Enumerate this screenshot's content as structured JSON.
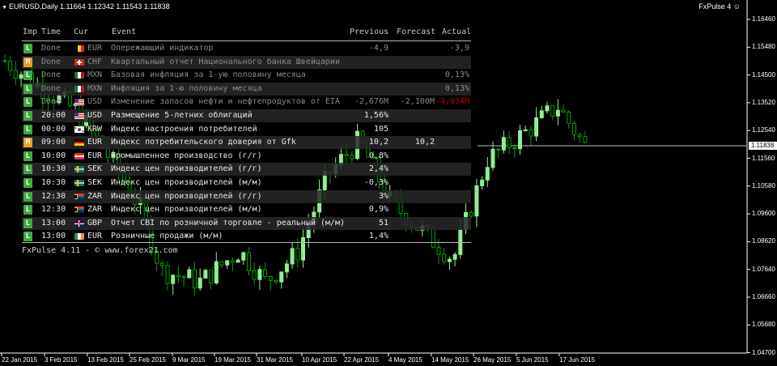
{
  "window": {
    "symbol_info": "EURUSD,Daily  1.11664 1.12342 1.11543 1.11838",
    "indicator_name": "FxPulse 4",
    "smiley": "☺"
  },
  "price_axis": {
    "labels": [
      "1.16460",
      "1.15480",
      "1.14500",
      "1.13520",
      "1.12540",
      "1.11560",
      "1.10580",
      "1.09600",
      "1.08620",
      "1.07640",
      "1.06660",
      "1.05680",
      "1.04700"
    ],
    "current_price": "1.11838"
  },
  "date_axis": {
    "labels": [
      "22 Jan 2015",
      "3 Feb 2015",
      "13 Feb 2015",
      "25 Feb 2015",
      "9 Mar 2015",
      "19 Mar 2015",
      "31 Mar 2015",
      "10 Apr 2015",
      "22 Apr 2015",
      "4 May 2015",
      "14 May 2015",
      "26 May 2015",
      "5 Jun 2015",
      "17 Jun 2015"
    ]
  },
  "colors": {
    "bull": "#90ee90",
    "bear": "#00a000",
    "imp_low": "#3caa3c",
    "imp_medium": "#e8a020",
    "negative_actual": "#cc0000"
  },
  "calendar": {
    "headers": {
      "imp": "Imp",
      "time": "Time",
      "cur": "Cur",
      "event": "Event",
      "previous": "Previous",
      "forecast": "Forecast",
      "actual": "Actual"
    },
    "rows": [
      {
        "imp": "L",
        "time": "Done",
        "cur": "EUR",
        "flag": "be",
        "event": "Опережающий индикатор",
        "previous": "-4,9",
        "forecast": "",
        "actual": "-3,9",
        "done": true,
        "actual_neg": false
      },
      {
        "imp": "M",
        "time": "Done",
        "cur": "CHF",
        "flag": "ch",
        "event": "Квартальный отчет Национального банка Швейцарии",
        "previous": "",
        "forecast": "",
        "actual": "",
        "done": true,
        "actual_neg": false
      },
      {
        "imp": "L",
        "time": "Done",
        "cur": "MXN",
        "flag": "mx",
        "event": "Базовая инфляция за 1-ую половину месяца",
        "previous": "",
        "forecast": "",
        "actual": "0,13%",
        "done": true,
        "actual_neg": false
      },
      {
        "imp": "L",
        "time": "Done",
        "cur": "MXN",
        "flag": "mx",
        "event": "Инфляция за 1-ю половину месяца",
        "previous": "",
        "forecast": "",
        "actual": "0,13%",
        "done": true,
        "actual_neg": false
      },
      {
        "imp": "L",
        "time": "Done",
        "cur": "USD",
        "flag": "us",
        "event": "Изменение запасов нефти и нефтепродуктов от EIA",
        "previous": "-2,676M",
        "forecast": "-2,100M",
        "actual": "-4,934M",
        "done": true,
        "actual_neg": true
      },
      {
        "imp": "L",
        "time": "20:00",
        "cur": "USD",
        "flag": "us",
        "event": "Размещение 5-летних облигаций",
        "previous": "1,56%",
        "forecast": "",
        "actual": "",
        "done": false,
        "actual_neg": false
      },
      {
        "imp": "L",
        "time": "00:00",
        "cur": "KRW",
        "flag": "kr",
        "event": "Индекс настроения потребителей",
        "previous": "105",
        "forecast": "",
        "actual": "",
        "done": false,
        "actual_neg": false
      },
      {
        "imp": "M",
        "time": "09:00",
        "cur": "EUR",
        "flag": "de",
        "event": "Индекс потребительского доверия от Gfk",
        "previous": "10,2",
        "forecast": "10,2",
        "actual": "",
        "done": false,
        "actual_neg": false
      },
      {
        "imp": "L",
        "time": "10:00",
        "cur": "EUR",
        "flag": "at",
        "event": "Промышленное производство (г/г)",
        "previous": "0,8%",
        "forecast": "",
        "actual": "",
        "done": false,
        "actual_neg": false
      },
      {
        "imp": "L",
        "time": "10:30",
        "cur": "SEK",
        "flag": "se",
        "event": "Индекс цен производителей (г/г)",
        "previous": "2,4%",
        "forecast": "",
        "actual": "",
        "done": false,
        "actual_neg": false
      },
      {
        "imp": "L",
        "time": "10:30",
        "cur": "SEK",
        "flag": "se",
        "event": "Индекс цен производителей (м/м)",
        "previous": "-0,3%",
        "forecast": "",
        "actual": "",
        "done": false,
        "actual_neg": false
      },
      {
        "imp": "L",
        "time": "12:30",
        "cur": "ZAR",
        "flag": "za",
        "event": "Индекс цен производителей (г/г)",
        "previous": "3%",
        "forecast": "",
        "actual": "",
        "done": false,
        "actual_neg": false
      },
      {
        "imp": "L",
        "time": "12:30",
        "cur": "ZAR",
        "flag": "za",
        "event": "Индекс цен производителей (м/м)",
        "previous": "0,9%",
        "forecast": "",
        "actual": "",
        "done": false,
        "actual_neg": false
      },
      {
        "imp": "L",
        "time": "13:00",
        "cur": "GBP",
        "flag": "gb",
        "event": "Отчет CBI по розничной торговле - реальный (м/м)",
        "previous": "51",
        "forecast": "",
        "actual": "",
        "done": false,
        "actual_neg": false
      },
      {
        "imp": "L",
        "time": "13:00",
        "cur": "EUR",
        "flag": "ie",
        "event": "Розничные продажи (м/м)",
        "previous": "1,4%",
        "forecast": "",
        "actual": "",
        "done": false,
        "actual_neg": false
      }
    ],
    "footer": "FxPulse 4.11 - © www.forex21.com"
  }
}
